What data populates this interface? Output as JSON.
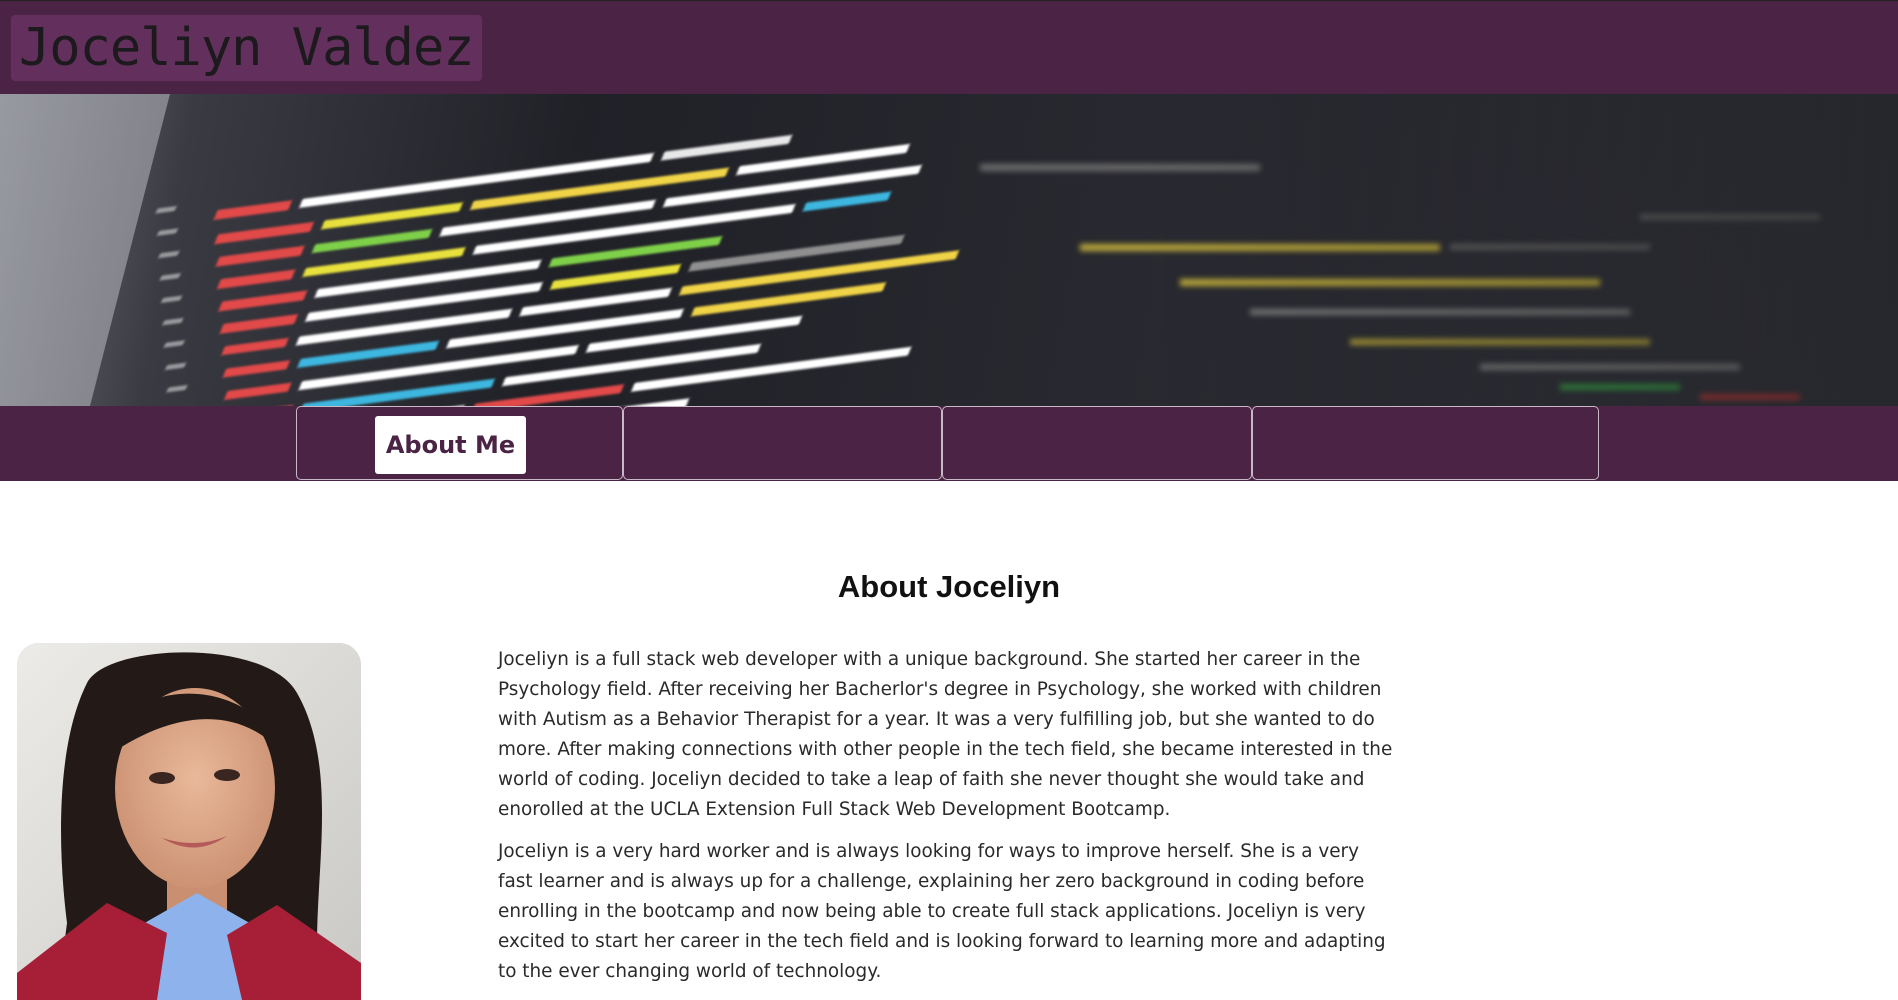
{
  "header": {
    "site_title": "Joceliyn Valdez"
  },
  "nav": {
    "items": [
      {
        "label": "About Me",
        "active": true
      },
      {
        "label": "",
        "active": false
      },
      {
        "label": "",
        "active": false
      },
      {
        "label": "",
        "active": false
      }
    ]
  },
  "about": {
    "title": "About Joceliyn",
    "paragraphs": [
      "Joceliyn is a full stack web developer with a unique background. She started her career in the Psychology field. After receiving her Bacherlor's degree in Psychology, she worked with children with Autism as a Behavior Therapist for a year. It was a very fulfilling job, but she wanted to do more. After making connections with other people in the tech field, she became interested in the world of coding. Joceliyn decided to take a leap of faith she never thought she would take and enorolled at the UCLA Extension Full Stack Web Development Bootcamp.",
      "Joceliyn is a very hard worker and is always looking for ways to improve herself. She is a very fast learner and is always up for a challenge, explaining her zero background in coding before enrolling in the bootcamp and now being able to create full stack applications. Joceliyn is very excited to start her career in the tech field and is looking forward to learning more and adapting to the ever changing world of technology."
    ]
  },
  "colors": {
    "brand": "#4a2345",
    "title_highlight": "#63305e",
    "nav_active_bg": "#ffffff",
    "nav_active_text": "#4a2345"
  }
}
